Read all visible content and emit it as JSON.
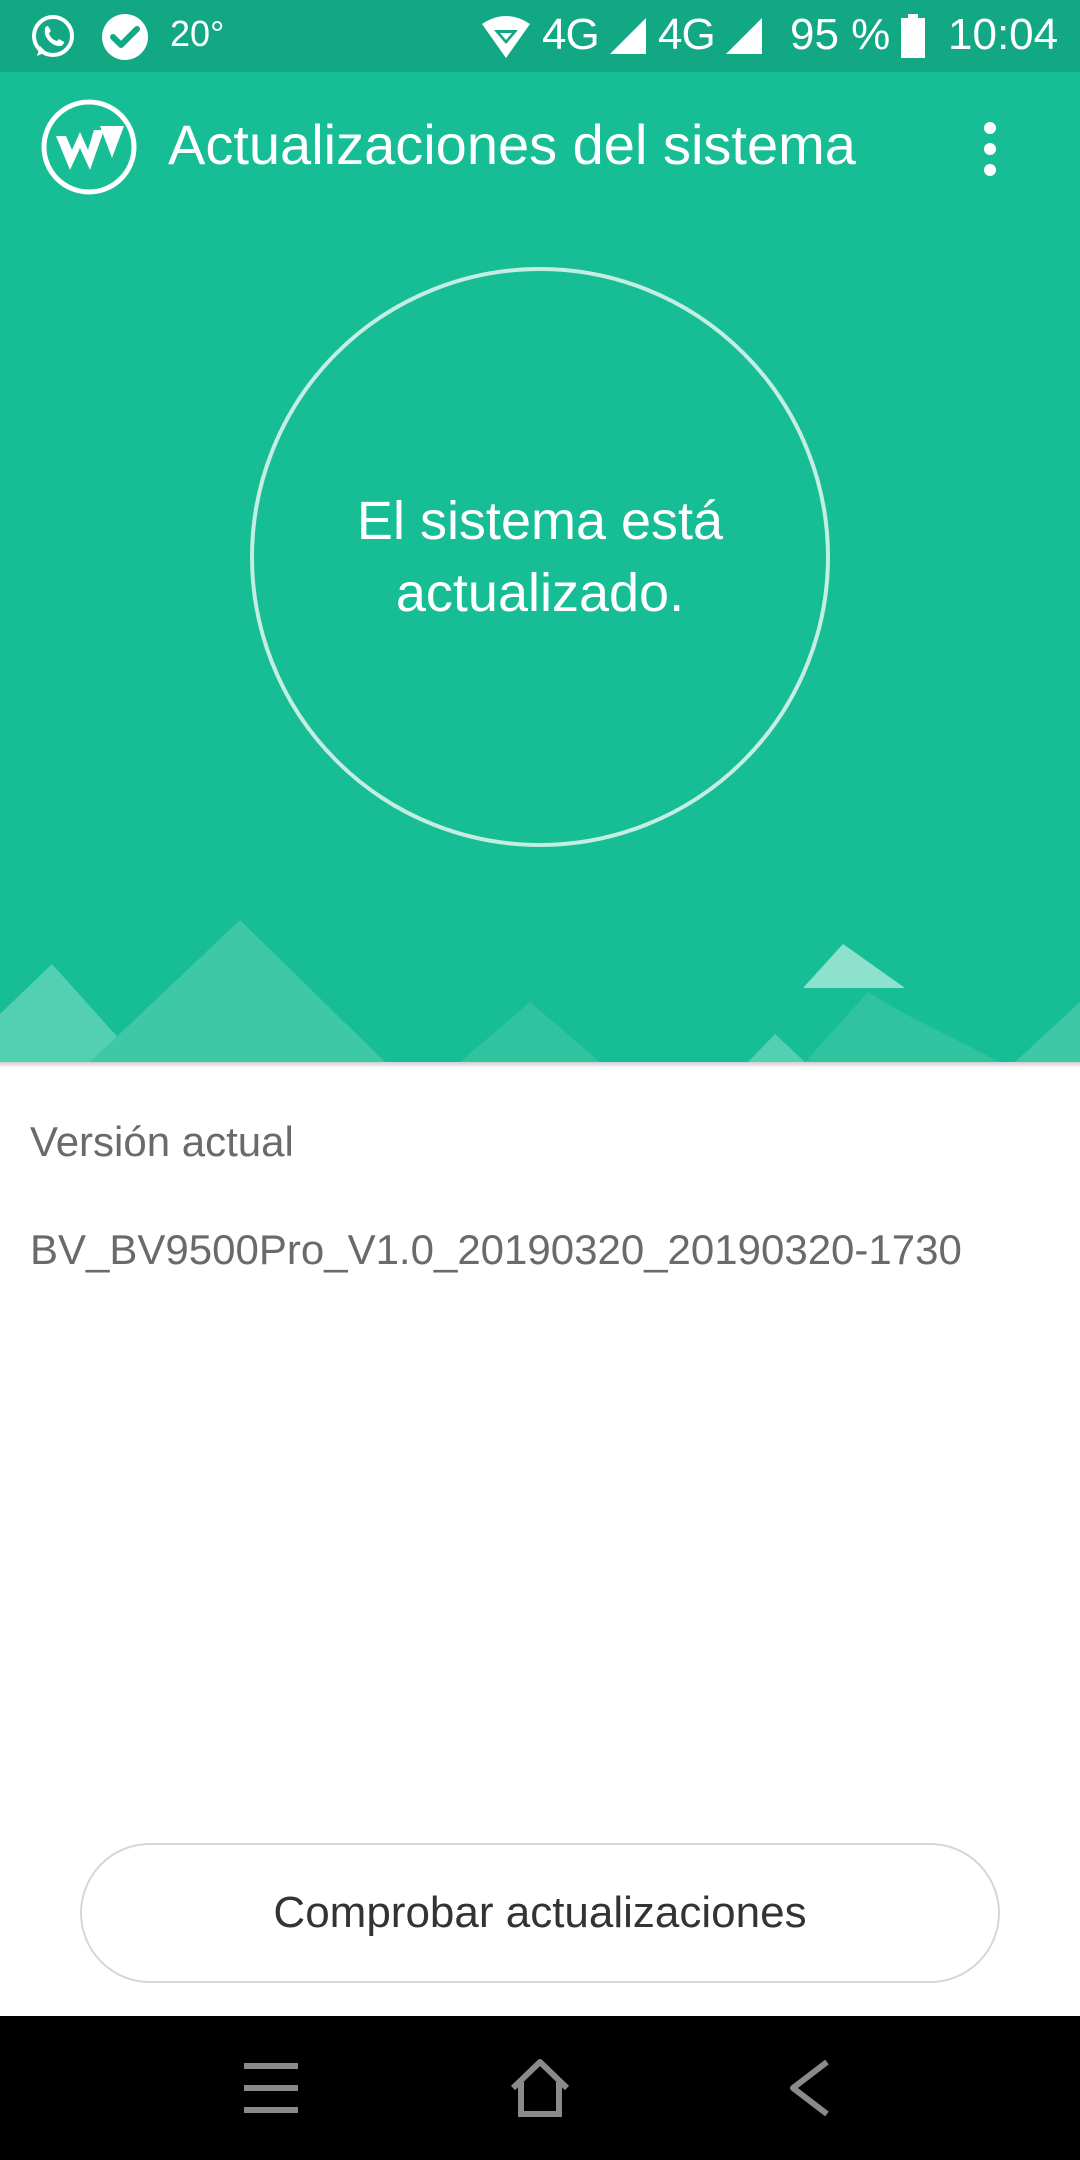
{
  "status_bar": {
    "temperature": "20°",
    "network1": "4G",
    "network2": "4G",
    "battery_percent": "95 %",
    "time": "10:04",
    "icons": [
      "whatsapp-icon",
      "check-circle-icon",
      "hotspot-icon",
      "signal-icon",
      "signal-icon",
      "battery-icon"
    ]
  },
  "header": {
    "title": "Actualizaciones del sistema",
    "menu_icon": "more-vert-icon",
    "logo_icon": "app-logo-icon"
  },
  "hero": {
    "status_message": "El sistema está actualizado."
  },
  "version": {
    "label": "Versión actual",
    "value": "BV_BV9500Pro_V1.0_20190320_20190320-1730"
  },
  "actions": {
    "check_updates_label": "Comprobar actualizaciones"
  },
  "nav_bar": {
    "icons": [
      "menu-icon",
      "home-icon",
      "back-icon"
    ]
  },
  "colors": {
    "accent": "#17bd94",
    "status_bar": "#12a883",
    "text_secondary": "#6a6a6a",
    "nav_bar": "#000000"
  }
}
